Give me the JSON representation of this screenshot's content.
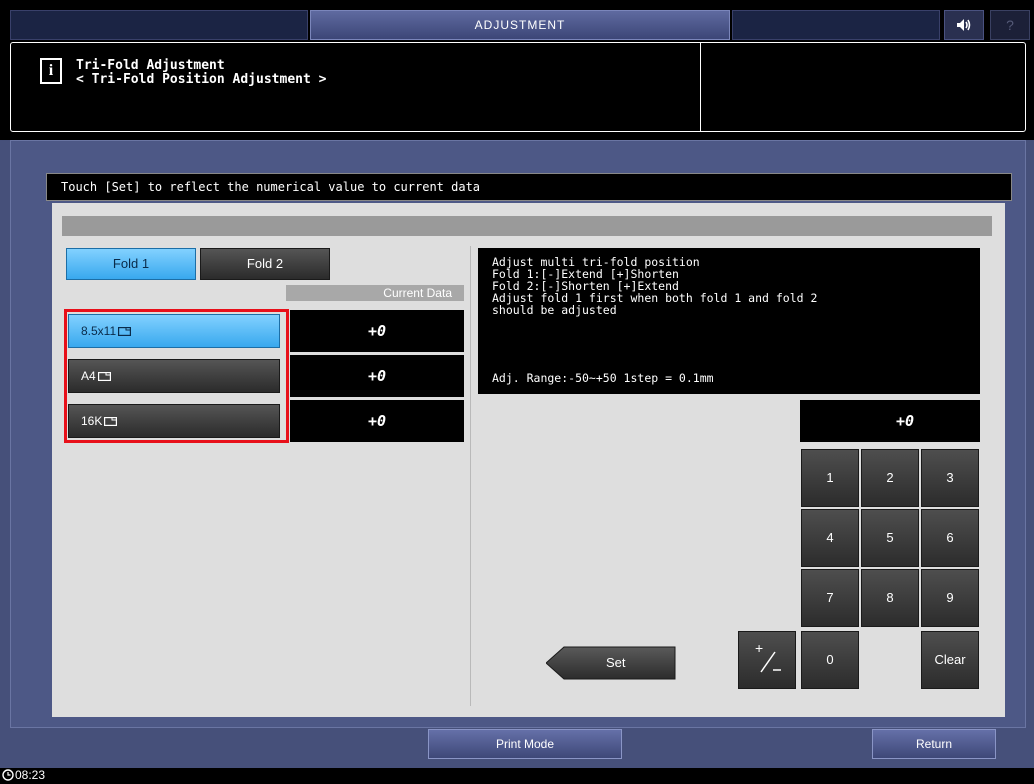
{
  "topbar": {
    "mode_label": "ADJUSTMENT",
    "help_label": "?",
    "sound_icon": "speaker-icon"
  },
  "header": {
    "title": "Tri-Fold Adjustment",
    "subtitle": "< Tri-Fold Position Adjustment >",
    "info_icon": "info-icon",
    "info_glyph": "i"
  },
  "instruction": "Touch [Set] to reflect the numerical value to current data",
  "tabs": [
    {
      "label": "Fold 1",
      "selected": true
    },
    {
      "label": "Fold 2",
      "selected": false
    }
  ],
  "current_data_header": "Current Data",
  "paper_rows": [
    {
      "label": "8.5x11",
      "value": "+0",
      "selected": true
    },
    {
      "label": "A4",
      "value": "+0",
      "selected": false
    },
    {
      "label": "16K",
      "value": "+0",
      "selected": false
    }
  ],
  "info_text": "Adjust multi tri-fold position\nFold 1:[-]Extend [+]Shorten\nFold 2:[-]Shorten [+]Extend\nAdjust fold 1 first when both fold 1 and fold 2\nshould be adjusted",
  "range_text": "Adj. Range:-50~+50 1step = 0.1mm",
  "numeric_value": "+0",
  "keypad": {
    "k1": "1",
    "k2": "2",
    "k3": "3",
    "k4": "4",
    "k5": "5",
    "k6": "6",
    "k7": "7",
    "k8": "8",
    "k9": "9",
    "k0": "0",
    "clear": "Clear",
    "plus": "+",
    "minus": "∕_"
  },
  "set_label": "Set",
  "bottom": {
    "print_mode": "Print Mode",
    "return": "Return"
  },
  "clock": "08:23",
  "colors": {
    "accent_blue": "#38a8ee",
    "frame_blue": "#4d5886",
    "highlight_red": "#e8101a"
  }
}
